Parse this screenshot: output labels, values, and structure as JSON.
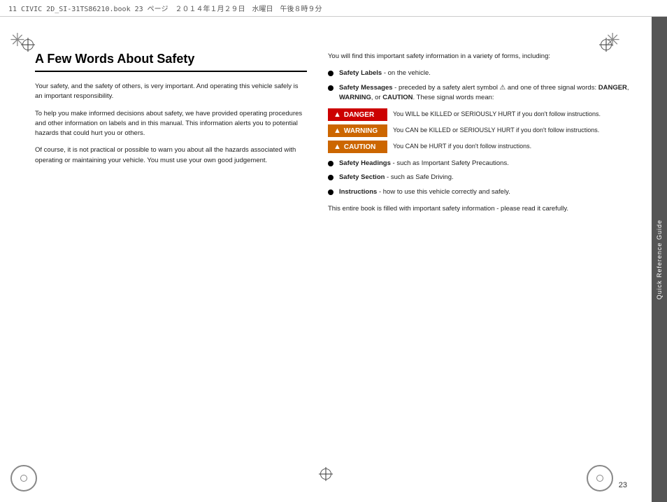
{
  "header": {
    "file_info": "11 CIVIC 2D_SI-31TS86210.book  23 ページ　２０１４年１月２９日　水曜日　午後８時９分"
  },
  "sidebar": {
    "tab_label": "Quick Reference Guide"
  },
  "page_number": "23",
  "content": {
    "title": "A Few Words About Safety",
    "left_paragraphs": [
      "Your safety, and the safety of others, is very important.  And operating this vehicle safely is an important responsibility.",
      "To help you make informed decisions about safety, we have provided operating procedures and other information on labels and in this manual. This information alerts you to potential hazards that could hurt you or others.",
      "Of course, it is not practical or possible to warn you about all the hazards associated with operating or maintaining your vehicle. You must use your own good judgement."
    ],
    "right_intro": "You will find this important safety information in a variety of forms, including:",
    "bullet_items": [
      {
        "label": "Safety Labels",
        "text": " - on the vehicle."
      },
      {
        "label": "Safety Messages",
        "text": " - preceded by a safety alert symbol ⚠ and one of three signal words: ",
        "bold_words": [
          "DANGER",
          "WARNING",
          "CAUTION"
        ],
        "text2": ". These signal words mean:"
      },
      {
        "label": "Safety Headings",
        "text": " - such as Important Safety Precautions."
      },
      {
        "label": "Safety Section",
        "text": " - such as Safe Driving."
      },
      {
        "label": "Instructions",
        "text": " - how to use this vehicle correctly and safely."
      }
    ],
    "signal_words": [
      {
        "type": "danger",
        "label": "DANGER",
        "description": "You WILL be KILLED or SERIOUSLY HURT if you don't follow instructions."
      },
      {
        "type": "warning",
        "label": "WARNING",
        "description": "You CAN be KILLED or SERIOUSLY HURT if you don't follow instructions."
      },
      {
        "type": "caution",
        "label": "CAUTION",
        "description": "You CAN be HURT if you don't follow instructions."
      }
    ],
    "footer_text": "This entire book is filled with important safety information - please read it carefully."
  }
}
